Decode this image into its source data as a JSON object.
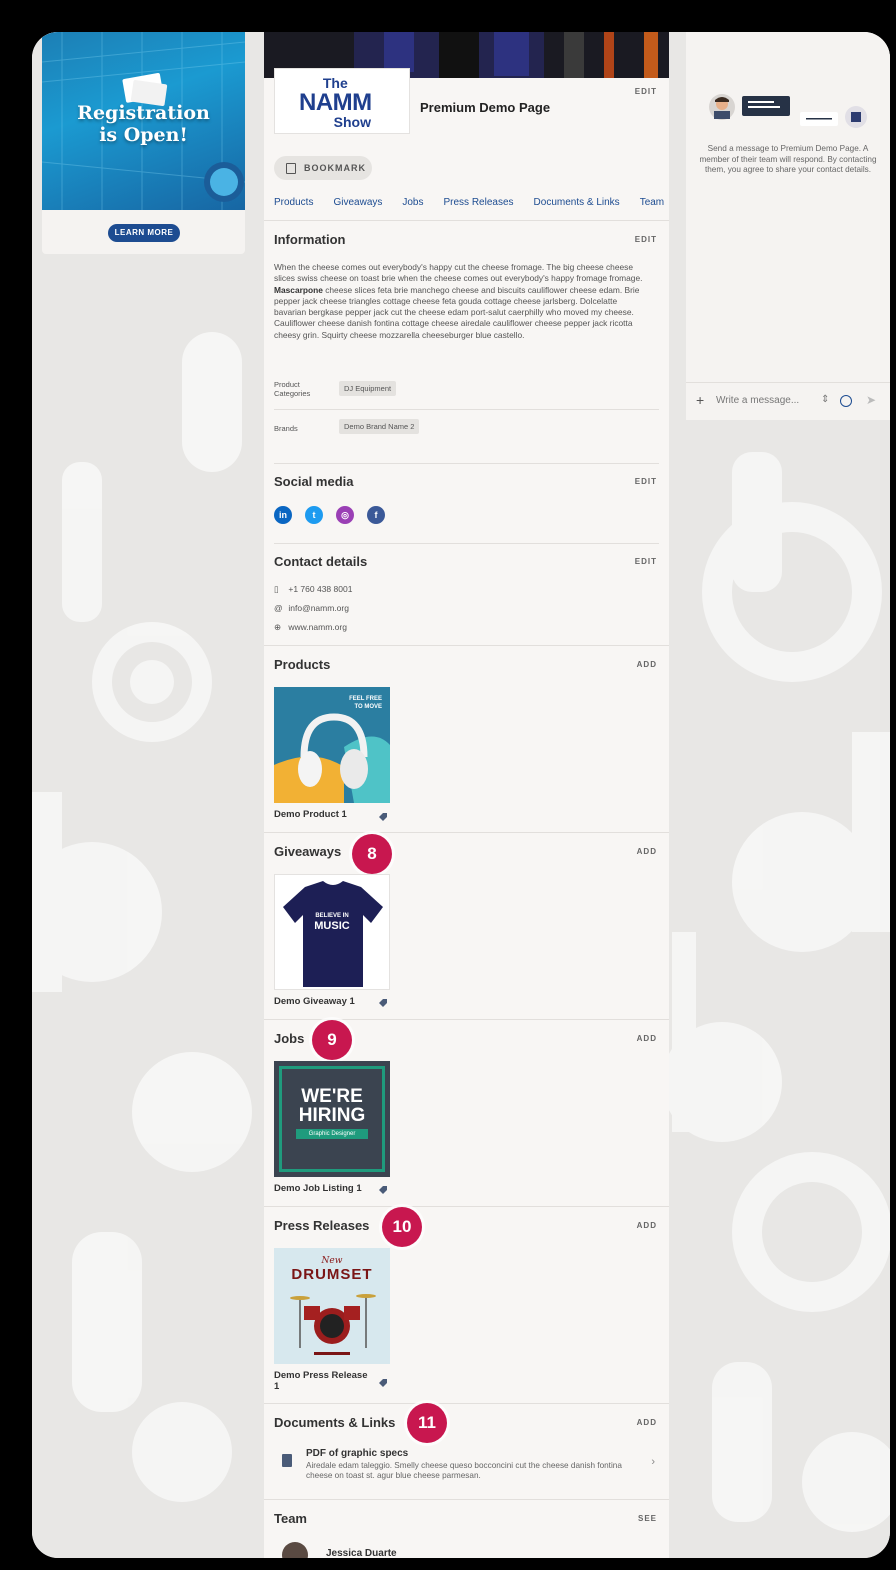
{
  "ad": {
    "title_line1": "Registration",
    "title_line2": "is Open!",
    "button": "LEARN MORE"
  },
  "exhibitor": {
    "logo_line1": "The",
    "logo_line2": "NAMM",
    "logo_line3": "Show",
    "name": "Premium Demo Page",
    "edit": "EDIT",
    "bookmark": "BOOKMARK",
    "tabs": [
      "Products",
      "Giveaways",
      "Jobs",
      "Press Releases",
      "Documents & Links",
      "Team"
    ]
  },
  "information": {
    "title": "Information",
    "edit": "EDIT",
    "text_before_bold": "When the cheese comes out everybody's happy cut the cheese fromage. The big cheese cheese slices swiss cheese on toast brie when the cheese comes out everybody's happy fromage fromage. ",
    "bold": "Mascarpone",
    "text_after_bold": " cheese slices feta brie manchego cheese and biscuits cauliflower cheese edam. Brie pepper jack cheese triangles cottage cheese feta gouda cottage cheese jarlsberg. Dolcelatte bavarian bergkase pepper jack cut the cheese edam port-salut caerphilly who moved my cheese. Cauliflower cheese danish fontina cottage cheese airedale cauliflower cheese pepper jack ricotta cheesy grin. Squirty cheese mozzarella cheeseburger blue castello.",
    "product_categories_label_1": "Product",
    "product_categories_label_2": "Categories",
    "product_category": "DJ Equipment",
    "brands_label": "Brands",
    "brand": "Demo Brand Name 2"
  },
  "social": {
    "title": "Social media",
    "edit": "EDIT",
    "icons": [
      "linkedin-icon",
      "twitter-icon",
      "instagram-icon",
      "facebook-icon"
    ]
  },
  "contact": {
    "title": "Contact details",
    "edit": "EDIT",
    "phone": "+1 760 438 8001",
    "email": "info@namm.org",
    "website": "www.namm.org"
  },
  "products": {
    "title": "Products",
    "action": "ADD",
    "item": "Demo Product 1",
    "image_text_1": "FEEL FREE",
    "image_text_2": "TO MOVE"
  },
  "giveaways": {
    "title": "Giveaways",
    "action": "ADD",
    "item": "Demo Giveaway 1",
    "badge": "8",
    "shirt_text_1": "BELIEVE IN",
    "shirt_text_2": "MUSIC"
  },
  "jobs": {
    "title": "Jobs",
    "action": "ADD",
    "item": "Demo Job Listing 1",
    "badge": "9",
    "image_text_1": "WE'RE",
    "image_text_2": "HIRING",
    "image_text_3": "Graphic Designer"
  },
  "press": {
    "title": "Press Releases",
    "action": "ADD",
    "item_line1": "Demo Press Release",
    "item_line2": "1",
    "badge": "10",
    "image_text_1": "New",
    "image_text_2": "DRUMSET"
  },
  "documents": {
    "title": "Documents & Links",
    "action": "ADD",
    "badge": "11",
    "doc_title": "PDF of graphic specs",
    "doc_desc": "Airedale edam taleggio. Smelly cheese queso bocconcini cut the cheese danish fontina cheese on toast st. agur blue cheese parmesan."
  },
  "team": {
    "title": "Team",
    "action": "SEE",
    "member": "Jessica Duarte"
  },
  "chat": {
    "description": "Send a message to Premium Demo Page. A member of their team will respond. By contacting them, you agree to share your contact details.",
    "placeholder": "Write a message..."
  },
  "colors": {
    "accent": "#1d4c91",
    "badge": "#c8174f"
  }
}
